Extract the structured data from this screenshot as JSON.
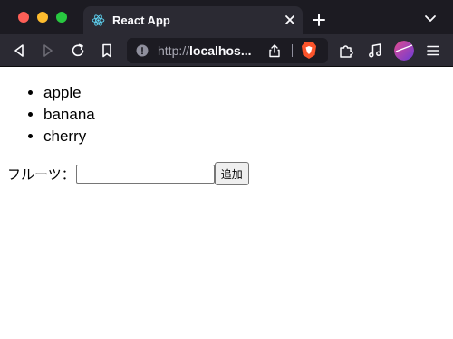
{
  "browser": {
    "tab": {
      "title": "React App",
      "favicon": "react-icon"
    },
    "url": {
      "scheme": "http://",
      "host": "localhos...",
      "full": "http://localhos..."
    },
    "icons": [
      "back-icon",
      "forward-icon",
      "reload-icon",
      "bookmark-icon",
      "site-info-icon",
      "share-icon",
      "brave-shields-icon",
      "extensions-icon",
      "media-icon",
      "avatar",
      "menu-icon"
    ],
    "colors": {
      "tab_strip": "#1c1b22",
      "toolbar": "#2b2a33",
      "url_bar": "#1c1b22",
      "text": "#fbfbfe"
    }
  },
  "page": {
    "fruits": [
      "apple",
      "banana",
      "cherry"
    ],
    "form": {
      "label": "フルーツ：",
      "input_value": "",
      "button_label": "追加"
    }
  }
}
